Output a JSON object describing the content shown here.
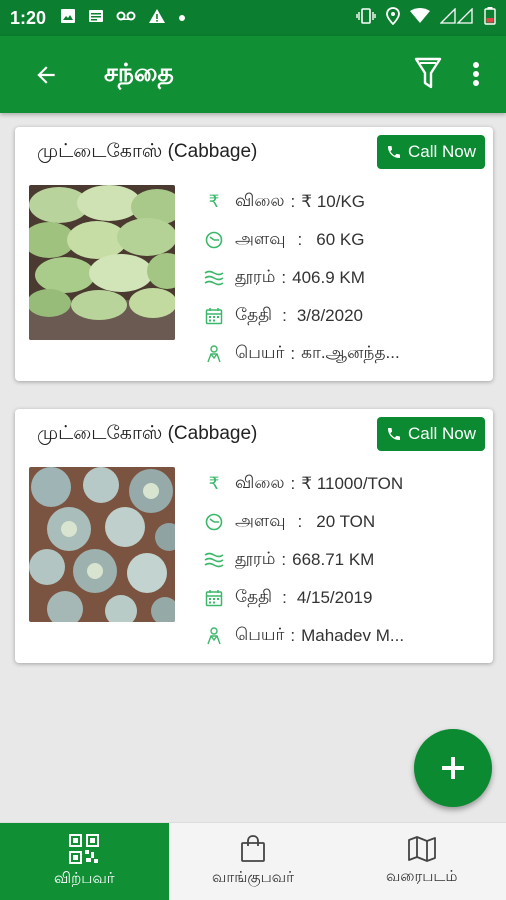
{
  "status_bar": {
    "time": "1:20",
    "icons_left": [
      "image-icon",
      "news-icon",
      "voicemail-icon",
      "warning-icon",
      "dot-icon"
    ],
    "icons_right": [
      "vibrate-icon",
      "location-icon",
      "wifi-icon",
      "signal-icon",
      "battery-icon"
    ]
  },
  "app_bar": {
    "title": "சந்தை"
  },
  "colors": {
    "primary": "#118f35",
    "primary_dark": "#0b7e2f",
    "accent": "#0b8a31",
    "icon_green": "#3bb86a"
  },
  "listings": [
    {
      "title": "முட்டைகோஸ் (Cabbage)",
      "call_label": "Call Now",
      "price_label": "விலை",
      "price_value": "₹ 10/KG",
      "quantity_label": "அளவு",
      "quantity_value": "60 KG",
      "distance_label": "தூரம்",
      "distance_value": "406.9 KM",
      "date_label": "தேதி",
      "date_value": "3/8/2020",
      "name_label": "பெயர்",
      "name_value": "கா.ஆனந்த..."
    },
    {
      "title": "முட்டைகோஸ் (Cabbage)",
      "call_label": "Call Now",
      "price_label": "விலை",
      "price_value": "₹ 11000/TON",
      "quantity_label": "அளவு",
      "quantity_value": "20 TON",
      "distance_label": "தூரம்",
      "distance_value": "668.71 KM",
      "date_label": "தேதி",
      "date_value": "4/15/2019",
      "name_label": "பெயர்",
      "name_value": "Mahadev M..."
    }
  ],
  "bottom_nav": [
    {
      "label": "விற்பவர்",
      "icon": "qr-seller-icon",
      "active": true
    },
    {
      "label": "வாங்குபவர்",
      "icon": "shopping-bag-icon",
      "active": false
    },
    {
      "label": "வரைபடம்",
      "icon": "map-icon",
      "active": false
    }
  ]
}
